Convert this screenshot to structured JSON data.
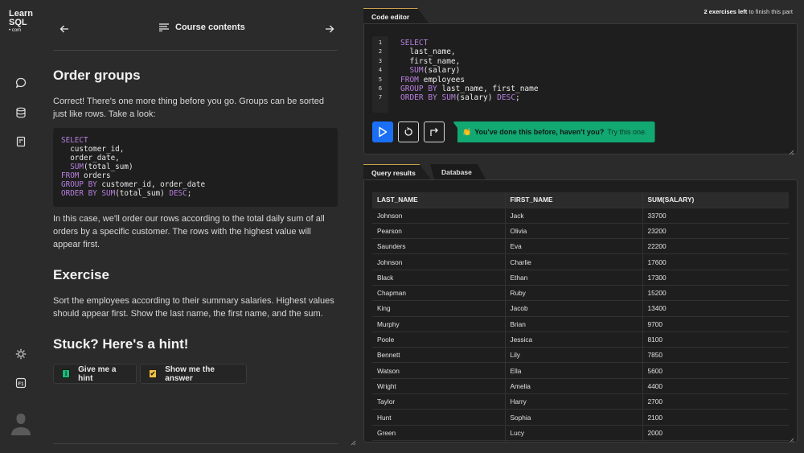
{
  "brand": {
    "line1": "Learn",
    "line2": "SQL",
    "line3": "• com"
  },
  "rail": {
    "top_icons": [
      "chat-icon",
      "database-icon",
      "notes-icon"
    ],
    "bottom_icons": [
      "theme-icon",
      "f1-help-icon",
      "user-avatar"
    ],
    "f1_label": "F1"
  },
  "lesson": {
    "nav": {
      "course_contents": "Course contents"
    },
    "title": "Order groups",
    "intro": "Correct! There's one more thing before you go. Groups can be sorted just like rows. Take a look:",
    "code_lines": [
      [
        {
          "t": "SELECT",
          "k": true
        }
      ],
      [
        {
          "t": "  customer_id,",
          "k": false
        }
      ],
      [
        {
          "t": "  order_date,",
          "k": false
        }
      ],
      [
        {
          "t": "  ",
          "k": false
        },
        {
          "t": "SUM",
          "k": true
        },
        {
          "t": "(total_sum)",
          "k": false
        }
      ],
      [
        {
          "t": "FROM",
          "k": true
        },
        {
          "t": " orders",
          "k": false
        }
      ],
      [
        {
          "t": "GROUP BY",
          "k": true
        },
        {
          "t": " customer_id, order_date",
          "k": false
        }
      ],
      [
        {
          "t": "ORDER BY",
          "k": true
        },
        {
          "t": " ",
          "k": false
        },
        {
          "t": "SUM",
          "k": true
        },
        {
          "t": "(total_sum) ",
          "k": false
        },
        {
          "t": "DESC",
          "k": true
        },
        {
          "t": ";",
          "k": false
        }
      ]
    ],
    "explanation": "In this case, we'll order our rows according to the total daily sum of all orders by a specific customer. The rows with the highest value will appear first.",
    "exercise_heading": "Exercise",
    "exercise_text": "Sort the employees according to their summary salaries. Highest values should appear first. Show the last name, the first name, and the sum.",
    "hint_heading": "Stuck? Here's a hint!",
    "hint_button": "Give me a hint",
    "hint_badge": "i",
    "answer_button": "Show me the answer",
    "answer_badge": "✔"
  },
  "editor": {
    "tab_label": "Code editor",
    "progress_count": "2 exercises left",
    "progress_rest": " to finish this part",
    "line_numbers": [
      "1",
      "2",
      "3",
      "4",
      "5",
      "6",
      "7"
    ],
    "code_lines": [
      [
        {
          "t": "SELECT",
          "k": true
        }
      ],
      [
        {
          "t": "  last_name,",
          "k": false
        }
      ],
      [
        {
          "t": "  first_name,",
          "k": false
        }
      ],
      [
        {
          "t": "  ",
          "k": false
        },
        {
          "t": "SUM",
          "k": true
        },
        {
          "t": "(salary)",
          "k": false
        }
      ],
      [
        {
          "t": "FROM",
          "k": true
        },
        {
          "t": " employees",
          "k": false
        }
      ],
      [
        {
          "t": "GROUP BY",
          "k": true
        },
        {
          "t": " last_name, first_name",
          "k": false
        }
      ],
      [
        {
          "t": "ORDER BY",
          "k": true
        },
        {
          "t": " ",
          "k": false
        },
        {
          "t": "SUM",
          "k": true
        },
        {
          "t": "(salary) ",
          "k": false
        },
        {
          "t": "DESC",
          "k": true
        },
        {
          "t": ";",
          "k": false
        }
      ]
    ],
    "tip_emoji": "👏",
    "tip_text": "You've done this before, haven't you?",
    "tip_link": "Try this one."
  },
  "results": {
    "tabs": [
      "Query results",
      "Database"
    ],
    "columns": [
      "LAST_NAME",
      "FIRST_NAME",
      "SUM(SALARY)"
    ],
    "rows": [
      [
        "Johnson",
        "Jack",
        "33700"
      ],
      [
        "Pearson",
        "Olivia",
        "23200"
      ],
      [
        "Saunders",
        "Eva",
        "22200"
      ],
      [
        "Johnson",
        "Charlie",
        "17600"
      ],
      [
        "Black",
        "Ethan",
        "17300"
      ],
      [
        "Chapman",
        "Ruby",
        "15200"
      ],
      [
        "King",
        "Jacob",
        "13400"
      ],
      [
        "Murphy",
        "Brian",
        "9700"
      ],
      [
        "Poole",
        "Jessica",
        "8100"
      ],
      [
        "Bennett",
        "Lily",
        "7850"
      ],
      [
        "Watson",
        "Ella",
        "5600"
      ],
      [
        "Wright",
        "Amelia",
        "4400"
      ],
      [
        "Taylor",
        "Harry",
        "2700"
      ],
      [
        "Hunt",
        "Sophia",
        "2100"
      ],
      [
        "Green",
        "Lucy",
        "2000"
      ]
    ]
  },
  "colors": {
    "run_button": "#1a6ff5",
    "tip_background": "#12a872",
    "keyword": "#b87fe0",
    "active_tab_accent": "#c9a34a",
    "hint_badge": "#1db87a",
    "answer_badge": "#f2c24a"
  }
}
